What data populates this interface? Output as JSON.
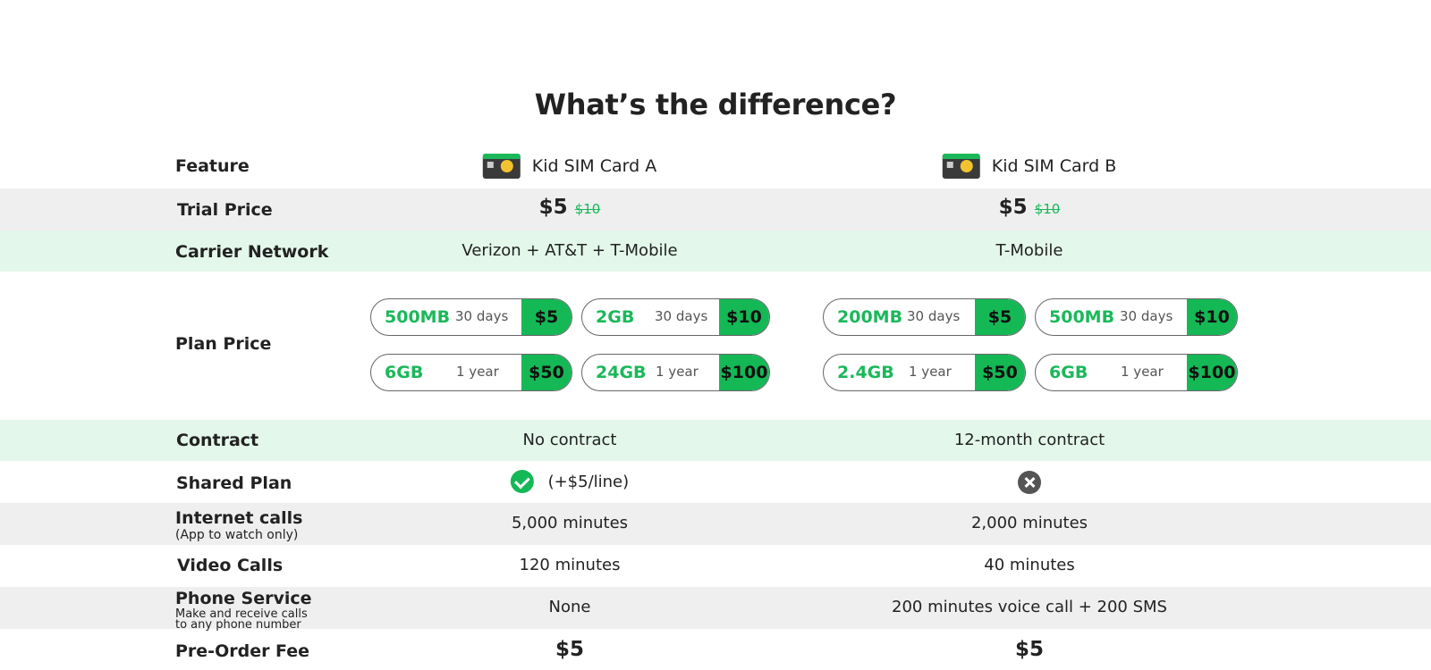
{
  "title": "What’s the difference?",
  "header": {
    "feature_label": "Feature",
    "card_a": "Kid SIM Card A",
    "card_b": "Kid SIM Card B",
    "card_icon": "sim-card-icon"
  },
  "trial_price": {
    "label": "Trial Price",
    "a_price": "$5",
    "a_old": "$10",
    "b_price": "$5",
    "b_old": "$10"
  },
  "carrier": {
    "label": "Carrier Network",
    "a": "Verizon + AT&T + T-Mobile",
    "b": "T-Mobile"
  },
  "plan_price": {
    "label": "Plan Price",
    "a": [
      {
        "data": "500MB",
        "duration": "30 days",
        "price": "$5"
      },
      {
        "data": "2GB",
        "duration": "30 days",
        "price": "$10"
      },
      {
        "data": "6GB",
        "duration": "1 year",
        "price": "$50"
      },
      {
        "data": "24GB",
        "duration": "1 year",
        "price": "$100"
      }
    ],
    "b": [
      {
        "data": "200MB",
        "duration": "30 days",
        "price": "$5"
      },
      {
        "data": "500MB",
        "duration": "30 days",
        "price": "$10"
      },
      {
        "data": "2.4GB",
        "duration": "1 year",
        "price": "$50"
      },
      {
        "data": "6GB",
        "duration": "1 year",
        "price": "$100"
      }
    ]
  },
  "contract": {
    "label": "Contract",
    "a": "No contract",
    "b": "12-month contract"
  },
  "shared_plan": {
    "label": "Shared Plan",
    "a_note": "(+$5/line)",
    "a_icon": "check-icon",
    "b_icon": "x-icon"
  },
  "internet_calls": {
    "label": "Internet calls",
    "sublabel": "(App to watch only)",
    "a": "5,000 minutes",
    "b": "2,000 minutes"
  },
  "video_calls": {
    "label": "Video Calls",
    "a": "120 minutes",
    "b": "40 minutes"
  },
  "phone_service": {
    "label": "Phone Service",
    "sublabel": "Make and receive calls to any phone number",
    "a": "None",
    "b": "200 minutes voice call + 200 SMS"
  },
  "preorder": {
    "label": "Pre-Order Fee",
    "a": "$5",
    "b": "$5"
  },
  "colors": {
    "accent_green": "#14b855",
    "row_gray": "#efefef",
    "row_green": "#e3f7eb"
  }
}
